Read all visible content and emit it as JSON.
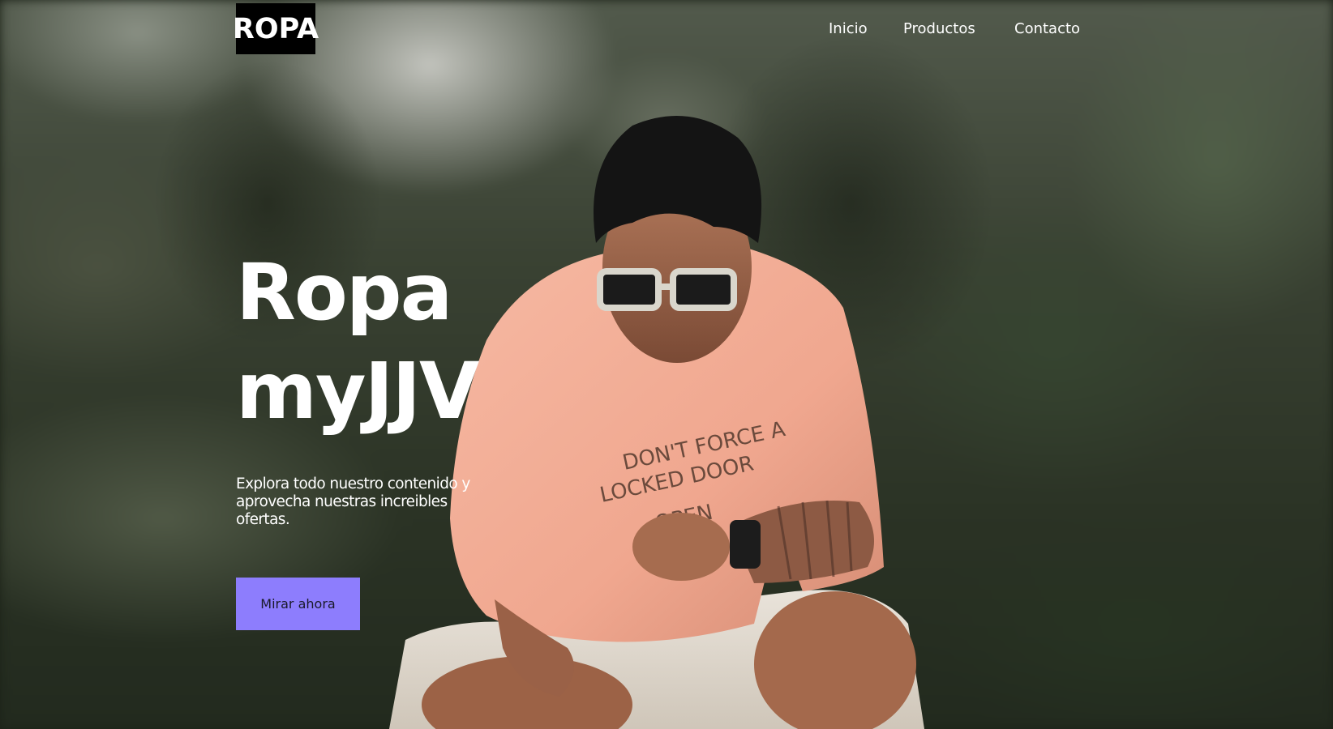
{
  "header": {
    "logo": "ROPA",
    "nav": [
      {
        "label": "Inicio"
      },
      {
        "label": "Productos"
      },
      {
        "label": "Contacto"
      }
    ]
  },
  "hero": {
    "title_line1": "Ropa",
    "title_line2": "myJJV",
    "subtitle": "Explora todo nuestro contenido y aprovecha nuestras increibles ofertas.",
    "cta_label": "Mirar ahora",
    "shirt_text_line1": "DON'T FORCE A",
    "shirt_text_line2": "LOCKED DOOR",
    "shirt_text_line3": "OPEN"
  },
  "colors": {
    "accent": "#8d7dfd",
    "logo_bg": "#000000",
    "text": "#ffffff",
    "shirt": "#f2a58e"
  }
}
